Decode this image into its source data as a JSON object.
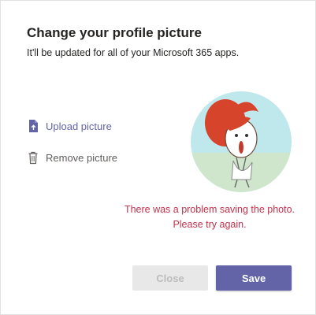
{
  "dialog": {
    "title": "Change your profile picture",
    "subtitle": "It'll be updated for all of your Microsoft 365 apps."
  },
  "actions": {
    "upload_label": "Upload picture",
    "upload_icon": "upload-file-icon",
    "remove_label": "Remove picture",
    "remove_icon": "trash-icon"
  },
  "error_message": "There was a problem saving the photo. Please try again.",
  "buttons": {
    "close_label": "Close",
    "close_disabled": true,
    "save_label": "Save"
  },
  "colors": {
    "accent": "#6264a7",
    "error": "#c4314b",
    "disabled_bg": "#e8e8e8",
    "disabled_text": "#bdbdbd"
  }
}
